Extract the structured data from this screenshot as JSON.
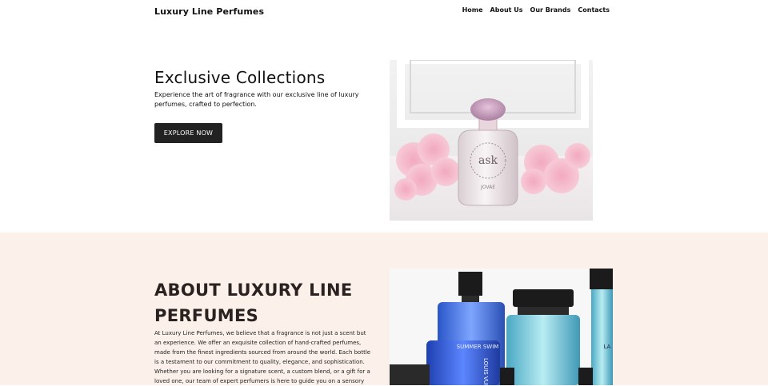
{
  "header": {
    "brand": "Luxury Line Perfumes",
    "nav": [
      "Home",
      "About Us",
      "Our Brands",
      "Contacts"
    ]
  },
  "hero": {
    "title": "Exclusive Collections",
    "description": "Experience the art of fragrance with our exclusive line of luxury perfumes, crafted to perfection.",
    "button_label": "EXPLORE NOW",
    "image_label": "ask",
    "image_sublabel": "JOVAE"
  },
  "about": {
    "title": "ABOUT LUXURY LINE PERFUMES",
    "text": "At Luxury Line Perfumes, we believe that a fragrance is not just a scent but an experience. We offer an exquisite collection of hand-crafted perfumes, made from the finest ingredients sourced from around the world. Each bottle is a testament to our commitment to quality, elegance, and sophistication. Whether you are looking for a signature scent, a custom blend, or a gift for a loved one, our team of expert perfumers is here to guide you on a sensory",
    "image_label_1": "SUMMER SWIM",
    "image_label_2": "LOUIS VUITTON"
  },
  "colors": {
    "button_bg": "#222222",
    "about_bg": "#fcf1ea"
  }
}
